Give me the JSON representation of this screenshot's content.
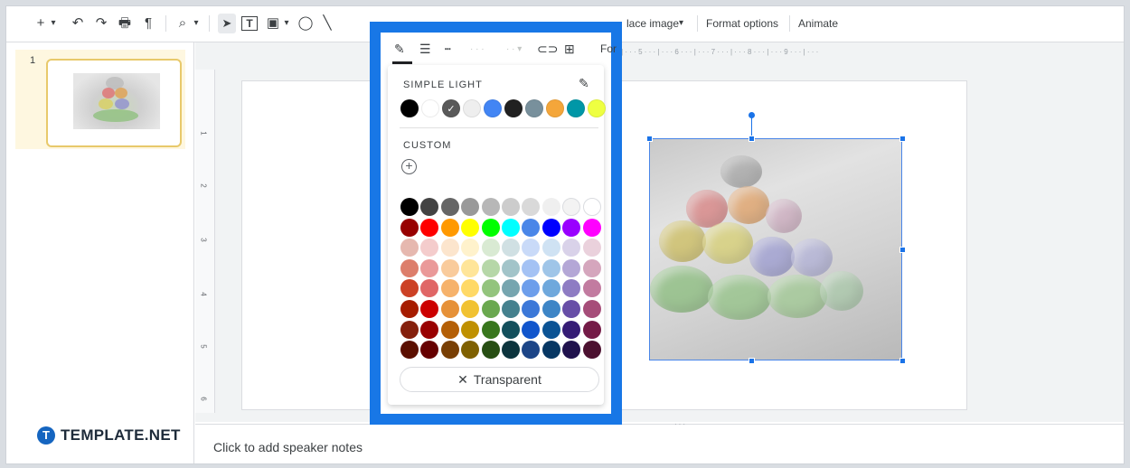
{
  "toolbar": {
    "new_slide_icon": "+",
    "dropdown_icon": "▾",
    "undo_icon": "↶",
    "redo_icon": "↷",
    "print_icon": "🖶",
    "paint_format_icon": "¶",
    "zoom_icon": "⌕",
    "select_icon": "➤",
    "textbox_icon": "T",
    "image_icon": "▣",
    "shape_icon": "◯",
    "line_icon": "╲",
    "replace_image_label": "lace image",
    "format_options_label": "Format options",
    "animate_label": "Animate",
    "format_partial_label": "For"
  },
  "color_menu": {
    "pen_icon": "✎",
    "theme_title": "SIMPLE LIGHT",
    "edit_theme_icon": "✎",
    "custom_title": "CUSTOM",
    "add_custom_icon": "+",
    "transparent_label": "Transparent",
    "transparent_icon": "✕",
    "theme_colors": [
      "#000000",
      "#ffffff",
      "#595959",
      "#eeeeee",
      "#4285f4",
      "#212121",
      "#78909c",
      "#f4a63a",
      "#0097a7",
      "#eeff41"
    ],
    "selected_theme_index": 2,
    "grid_colors": [
      [
        "#000000",
        "#434343",
        "#666666",
        "#999999",
        "#b7b7b7",
        "#cccccc",
        "#d9d9d9",
        "#efefef",
        "#f3f3f3",
        "#ffffff"
      ],
      [
        "#980000",
        "#ff0000",
        "#ff9900",
        "#ffff00",
        "#00ff00",
        "#00ffff",
        "#4a86e8",
        "#0000ff",
        "#9900ff",
        "#ff00ff"
      ],
      [
        "#e6b8af",
        "#f4cccc",
        "#fce5cd",
        "#fff2cc",
        "#d9ead3",
        "#d0e0e3",
        "#c9daf8",
        "#cfe2f3",
        "#d9d2e9",
        "#ead1dc"
      ],
      [
        "#dd7e6b",
        "#ea9999",
        "#f9cb9c",
        "#ffe599",
        "#b6d7a8",
        "#a2c4c9",
        "#a4c2f4",
        "#9fc5e8",
        "#b4a7d6",
        "#d5a6bd"
      ],
      [
        "#cc4125",
        "#e06666",
        "#f6b26b",
        "#ffd966",
        "#93c47d",
        "#76a5af",
        "#6d9eeb",
        "#6fa8dc",
        "#8e7cc3",
        "#c27ba0"
      ],
      [
        "#a61c00",
        "#cc0000",
        "#e69138",
        "#f1c232",
        "#6aa84f",
        "#45818e",
        "#3c78d8",
        "#3d85c6",
        "#674ea7",
        "#a64d79"
      ],
      [
        "#85200c",
        "#990000",
        "#b45f06",
        "#bf9000",
        "#38761d",
        "#134f5c",
        "#1155cc",
        "#0b5394",
        "#351c75",
        "#741b47"
      ],
      [
        "#5b0f00",
        "#660000",
        "#783f04",
        "#7f6000",
        "#274e13",
        "#0c343d",
        "#1c4587",
        "#073763",
        "#20124d",
        "#4c1130"
      ]
    ]
  },
  "filmstrip": {
    "slide_number": "1"
  },
  "ruler": {
    "vertical_numbers": [
      "1",
      "2",
      "3",
      "4",
      "5",
      "6"
    ]
  },
  "notes": {
    "placeholder": "Click to add speaker notes"
  },
  "brand": {
    "logo_letter": "T",
    "logo_text": "TEMPLATE.NET"
  },
  "colors": {
    "accent": "#1a73e8",
    "highlight_border": "#1877e6"
  }
}
